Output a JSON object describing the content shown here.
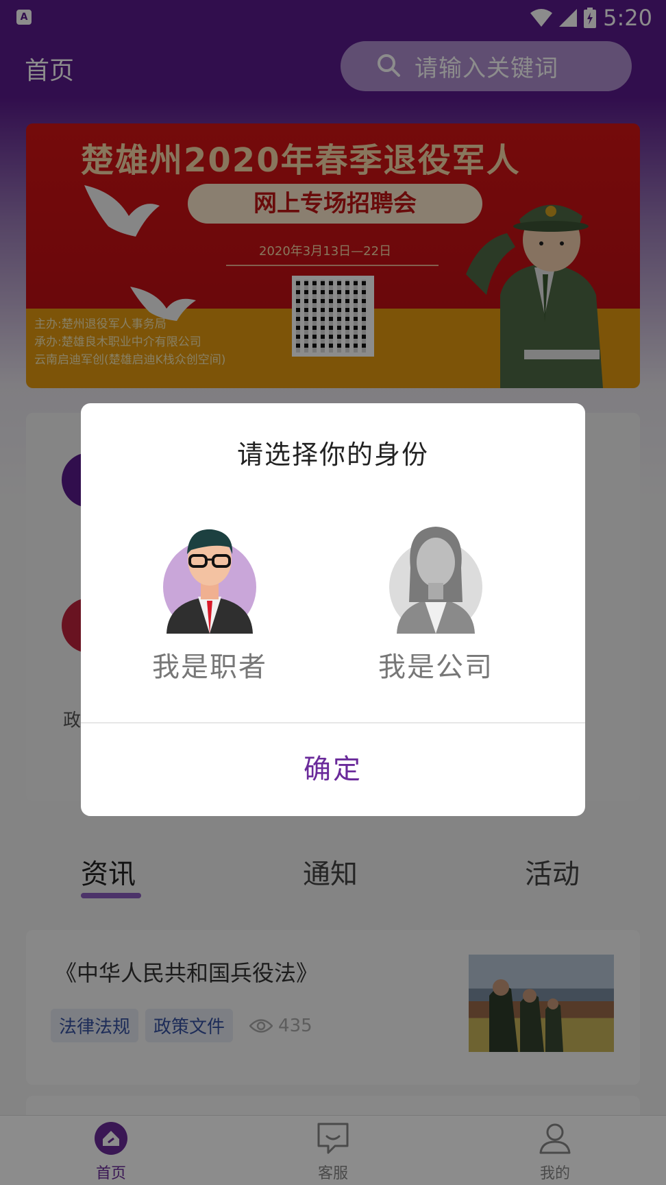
{
  "status_bar": {
    "time": "5:20",
    "icons": [
      "notification-a-icon",
      "wifi-icon",
      "signal-icon",
      "battery-icon"
    ]
  },
  "app_bar": {
    "title": "首页",
    "search_placeholder": "请输入关键词"
  },
  "banner": {
    "title": "楚雄州2020年春季退役军人",
    "subtitle": "网上专场招聘会",
    "date": "2020年3月13日—22日",
    "credits": [
      "主办:楚州退役军人事务局",
      "承办:楚雄良木职业中介有限公司",
      "云南启迪军创(楚雄启迪K栈众创空间)"
    ]
  },
  "menu_card": {
    "partial_label": "政"
  },
  "tabs": {
    "items": [
      {
        "label": "资讯",
        "active": true
      },
      {
        "label": "通知",
        "active": false
      },
      {
        "label": "活动",
        "active": false
      }
    ]
  },
  "news": [
    {
      "title": "《中华人民共和国兵役法》",
      "tags": [
        "法律法规",
        "政策文件"
      ],
      "views": "435"
    }
  ],
  "bottom_nav": {
    "items": [
      {
        "label": "首页",
        "icon": "home-icon",
        "active": true
      },
      {
        "label": "客服",
        "icon": "chat-icon",
        "active": false
      },
      {
        "label": "我的",
        "icon": "profile-icon",
        "active": false
      }
    ]
  },
  "dialog": {
    "title": "请选择你的身份",
    "options": [
      {
        "label": "我是职者",
        "icon": "job-seeker-avatar-icon",
        "selected": true
      },
      {
        "label": "我是公司",
        "icon": "company-avatar-icon",
        "selected": false
      }
    ],
    "confirm_label": "确定"
  },
  "colors": {
    "primary": "#5a1a8c",
    "accent": "#6a2a9a",
    "tag_text": "#3550a0"
  }
}
